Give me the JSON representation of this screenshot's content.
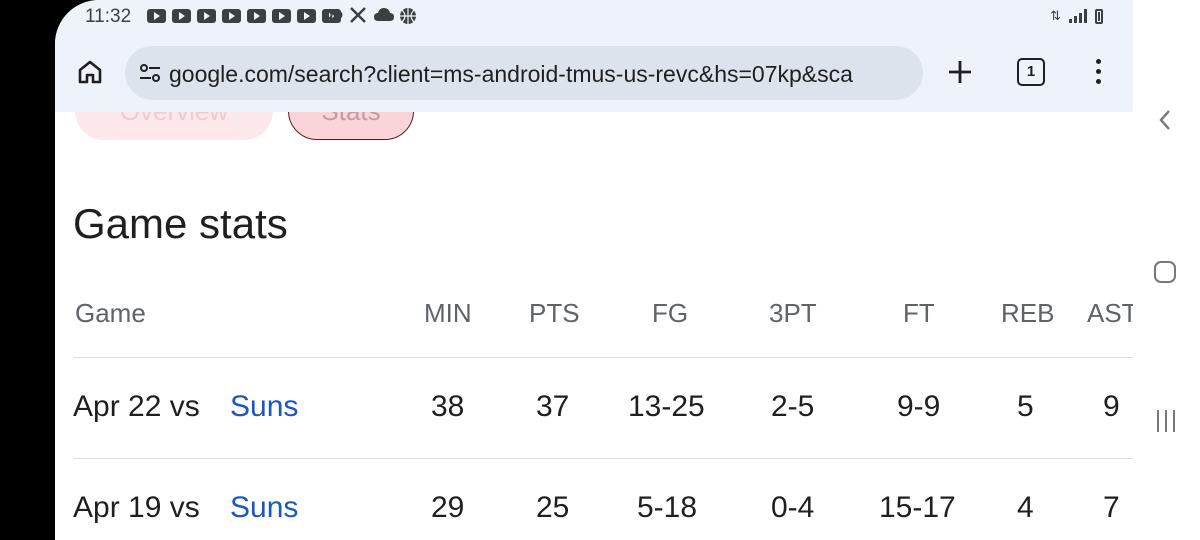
{
  "status_bar": {
    "time": "11:32",
    "notification_icons": [
      "youtube-icon",
      "youtube-icon",
      "youtube-icon",
      "youtube-icon",
      "youtube-icon",
      "youtube-icon",
      "youtube-icon",
      "youtube-icon",
      "voicemail-icon",
      "x-icon",
      "cloud-icon",
      "basketball-icon"
    ],
    "system_icons": [
      "data-arrows-icon",
      "signal-icon",
      "battery-icon"
    ]
  },
  "browser": {
    "url": "google.com/search?client=ms-android-tmus-us-revc&hs=07kp&sca",
    "tab_count": "1"
  },
  "chips": {
    "overview": "Overview",
    "stats": "Stats"
  },
  "section_title": "Game stats",
  "table": {
    "headers": [
      "Game",
      "MIN",
      "PTS",
      "FG",
      "3PT",
      "FT",
      "REB",
      "AST"
    ],
    "rows": [
      {
        "date": "Apr 22 vs",
        "opponent": "Suns",
        "min": "38",
        "pts": "37",
        "fg": "13-25",
        "tpt": "2-5",
        "ft": "9-9",
        "reb": "5",
        "ast": "9"
      },
      {
        "date": "Apr 19 vs",
        "opponent": "Suns",
        "min": "29",
        "pts": "25",
        "fg": "5-18",
        "tpt": "0-4",
        "ft": "15-17",
        "reb": "4",
        "ast": "7"
      }
    ]
  },
  "colors": {
    "link": "#1a56c4",
    "chrome_bg": "#eef3fb",
    "urlbar_bg": "#dde3ec"
  }
}
